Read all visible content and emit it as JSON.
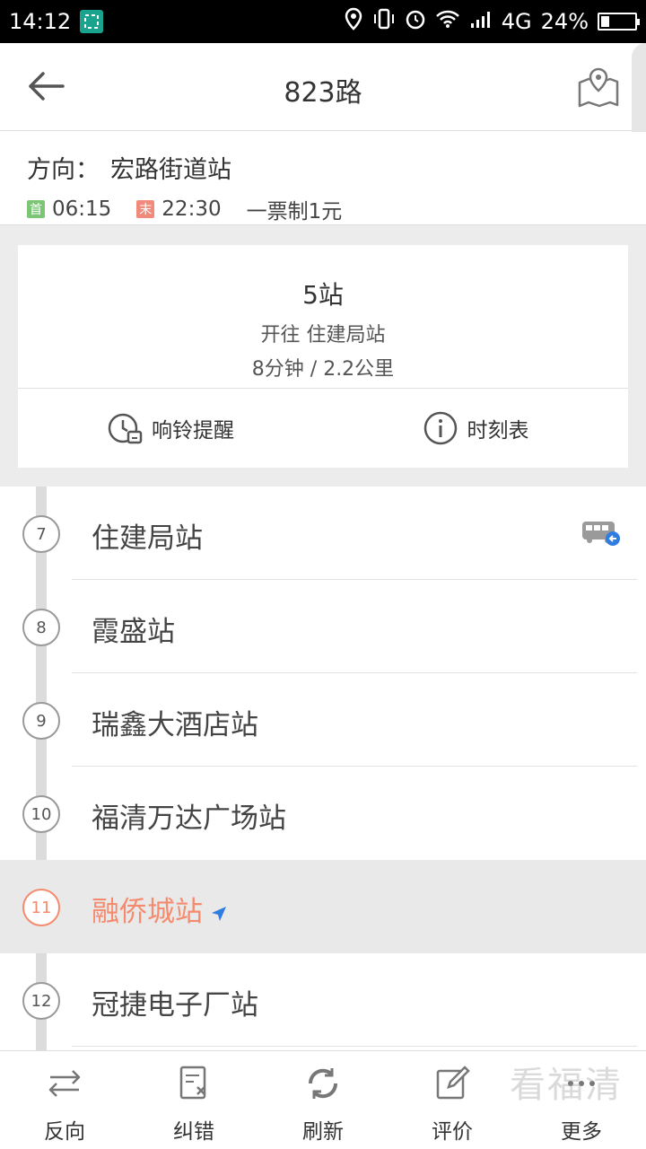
{
  "status_bar": {
    "time": "14:12",
    "network": "4G",
    "battery": "24%",
    "battery_level": 0.24
  },
  "header": {
    "title": "823路"
  },
  "direction": {
    "label": "方向：",
    "destination": "宏路街道站",
    "first_tag": "首",
    "first_time": "06:15",
    "last_tag": "末",
    "last_time": "22:30",
    "fare": "一票制1元"
  },
  "card": {
    "stops_away": "5站",
    "towards": "开往 住建局站",
    "eta": "8分钟 / 2.2公里",
    "alarm_label": "响铃提醒",
    "timetable_label": "时刻表"
  },
  "stops": [
    {
      "num": "7",
      "name": "住建局站"
    },
    {
      "num": "8",
      "name": "霞盛站"
    },
    {
      "num": "9",
      "name": "瑞鑫大酒店站"
    },
    {
      "num": "10",
      "name": "福清万达广场站"
    },
    {
      "num": "11",
      "name": "融侨城站"
    },
    {
      "num": "12",
      "name": "冠捷电子厂站"
    }
  ],
  "bottom_nav": {
    "reverse": "反向",
    "report": "纠错",
    "refresh": "刷新",
    "rate": "评价",
    "more": "更多"
  },
  "watermark": "看福清",
  "colors": {
    "accent": "#f58b6e",
    "first_tag": "#7cc576",
    "last_tag": "#f08a7a",
    "location_arrow": "#2f7de1"
  }
}
